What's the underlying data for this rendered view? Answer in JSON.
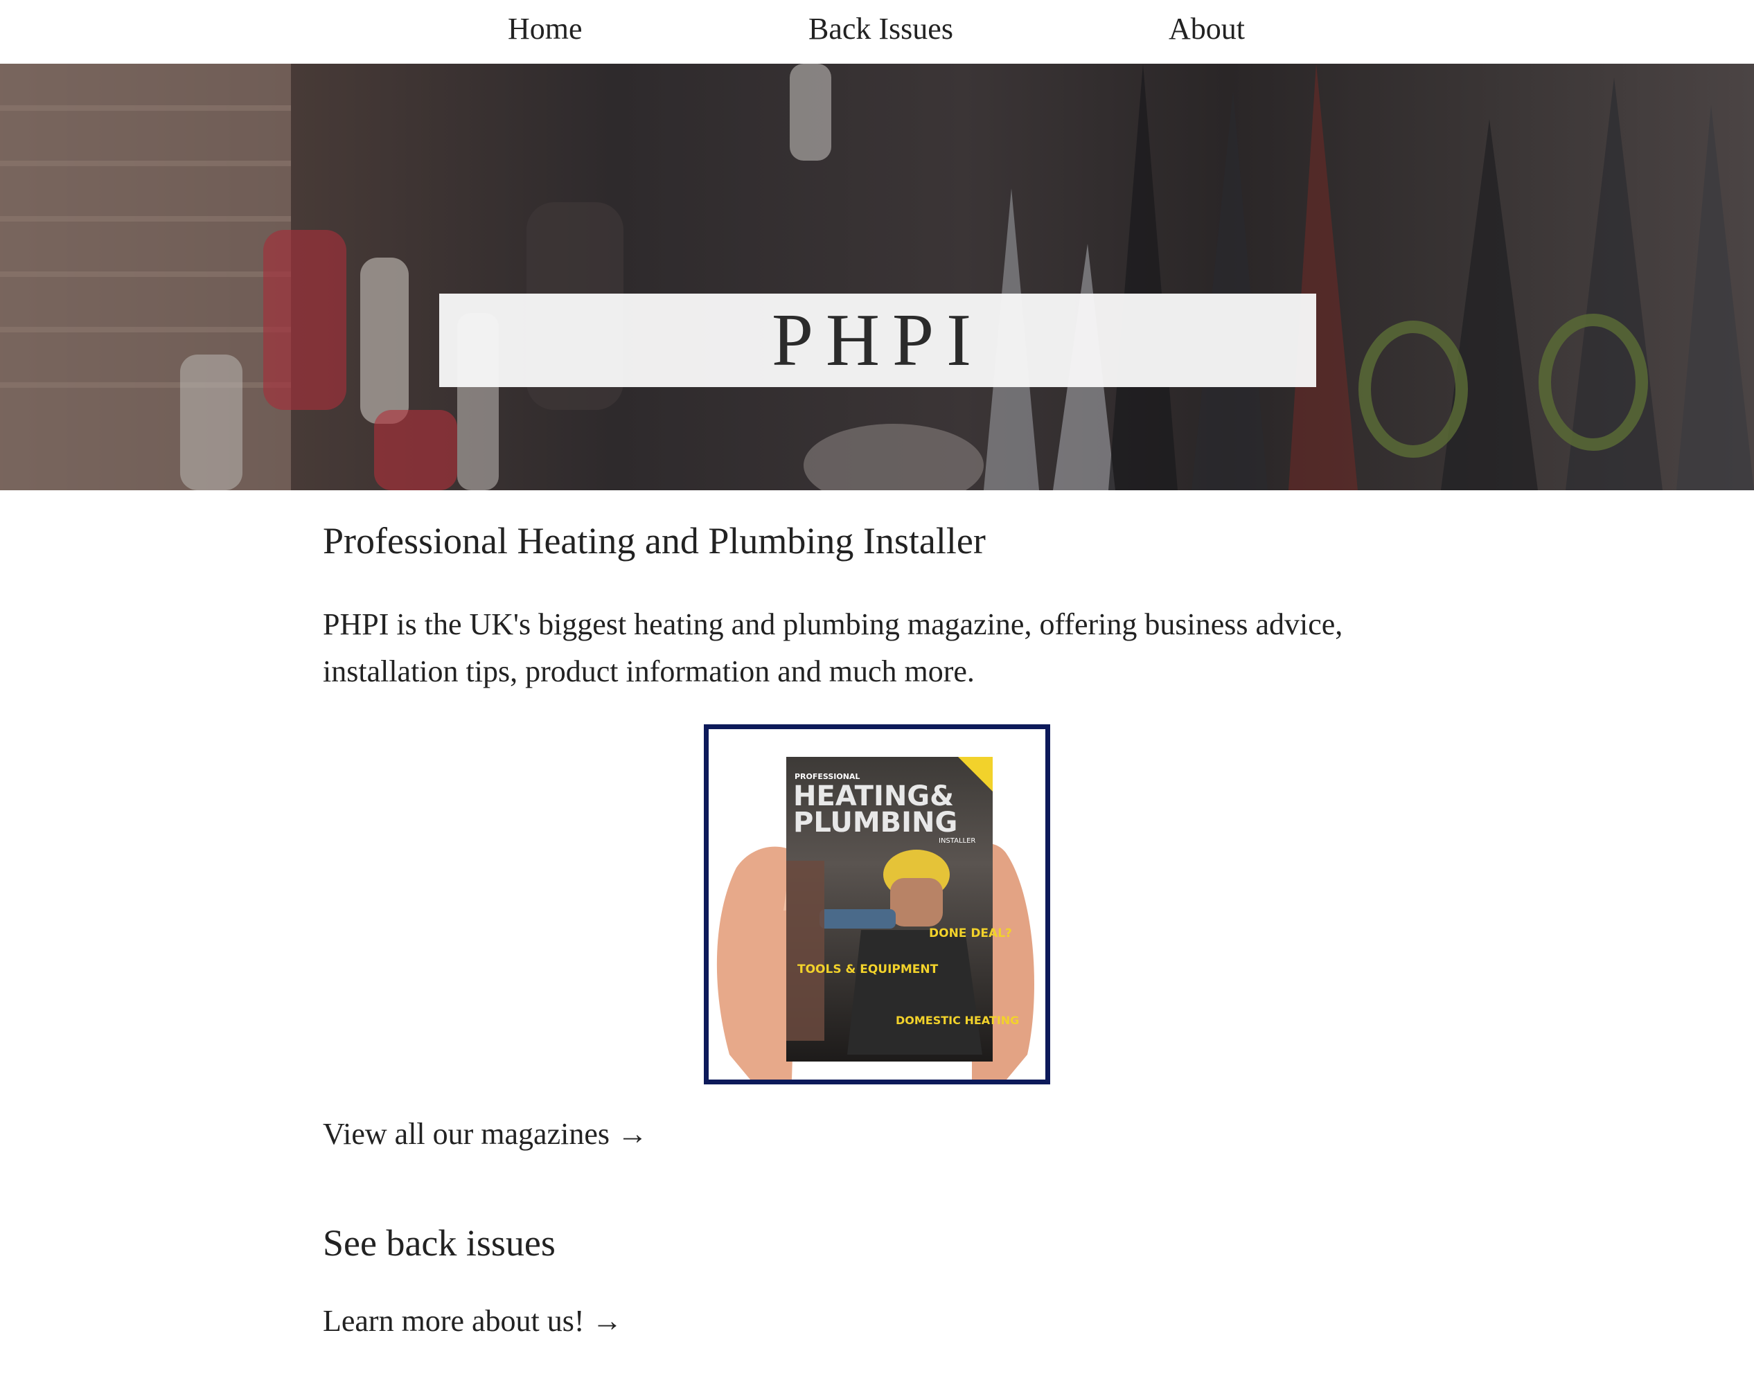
{
  "nav": {
    "items": [
      {
        "label": "Home"
      },
      {
        "label": "Back Issues"
      },
      {
        "label": "About"
      }
    ]
  },
  "hero": {
    "title": "PHPI",
    "image_icon": "tools-photo"
  },
  "main": {
    "subtitle": "Professional Heating and Plumbing Installer",
    "intro": "PHPI is the UK's biggest heating and plumbing magazine, offering business advice, installation tips, product information and much more.",
    "cover": {
      "masthead_small": "PROFESSIONAL",
      "masthead_line1": "HEATING&",
      "masthead_line2": "PLUMBING",
      "masthead_sub": "INSTALLER",
      "headline_1": "DONE DEAL?",
      "headline_2": "TOOLS & EQUIPMENT",
      "headline_3": "DOMESTIC HEATING",
      "frame_color": "#0d1a5a",
      "accent_color": "#f2d22b"
    },
    "magazines_link": "View all our magazines →",
    "back_issues_heading": "See back issues",
    "about_link": "Learn more about us! →"
  }
}
